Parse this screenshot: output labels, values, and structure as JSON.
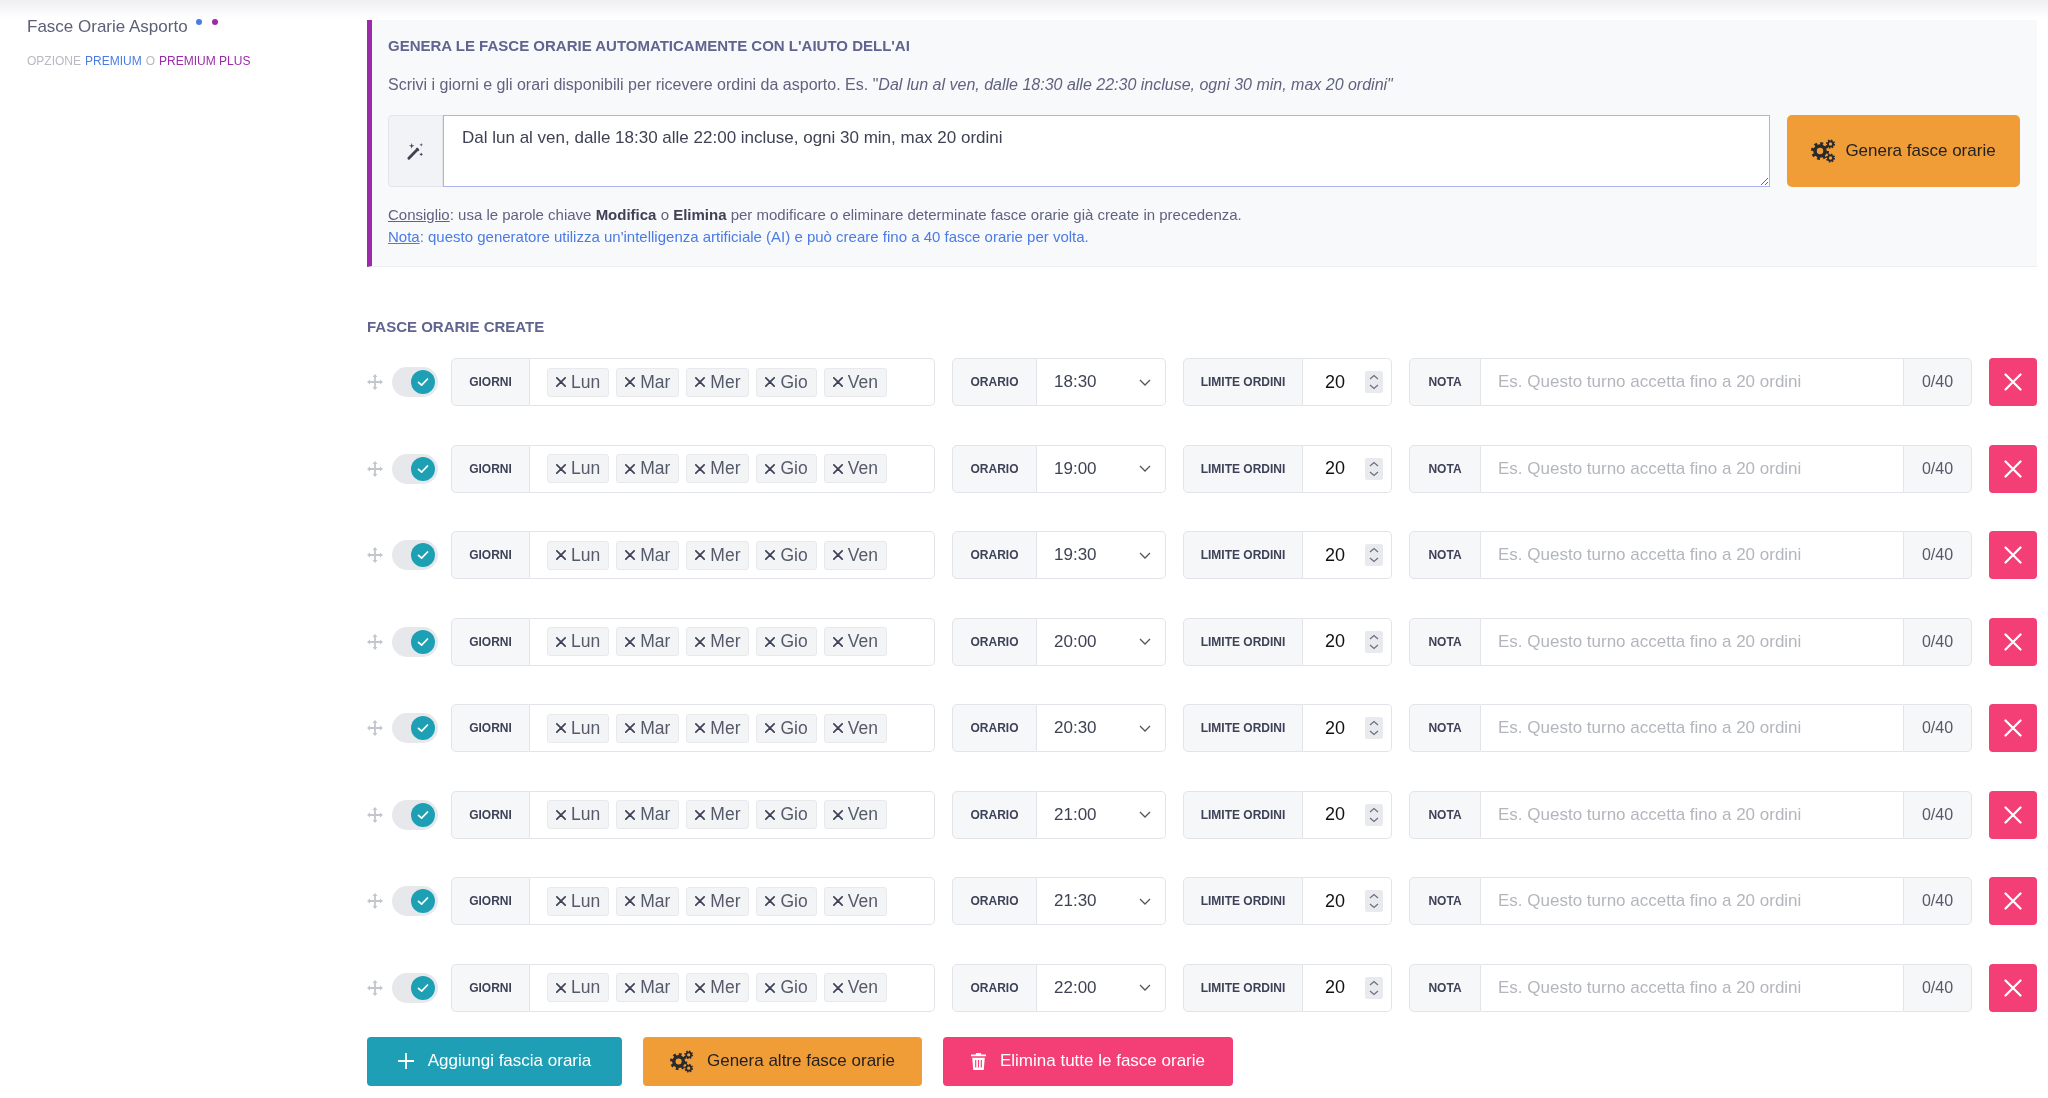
{
  "sidebar": {
    "title": "Fasce Orarie Asporto",
    "dots": [
      {
        "color": "#4b7be5"
      },
      {
        "color": "#9b2ba9"
      }
    ],
    "plan_note": {
      "prefix": "OPZIONE",
      "separator": "O",
      "plans": [
        {
          "name": "PREMIUM",
          "color": "#4b7be5"
        },
        {
          "name": "PREMIUM PLUS",
          "color": "#9b2ba9"
        }
      ]
    }
  },
  "ai_generator": {
    "title": "GENERA LE FASCE ORARIE AUTOMATICAMENTE CON L'AIUTO DELL'AI",
    "description": "Scrivi i giorni e gli orari disponibili per ricevere ordini da asporto. Es. \"*Dal lun al ven, dalle 18:30 alle 22:30 incluse, ogni 30 min, max 20 ordini\"*",
    "prompt": {
      "value": "Dal lun al ven, dalle 18:30 alle 22:00 incluse, ogni 30 min, max 20 ordini"
    },
    "button": {
      "label": "Genera fasce orarie"
    },
    "tip": {
      "link": "Consiglio",
      "text": ": usa le parole chiave **Modifica** o **Elimina** per modificare o eliminare determinate fasce orarie già create in precedenza."
    },
    "note": {
      "link": "Nota",
      "text": ": questo generatore utilizza un'intelligenza artificiale (AI) e può creare fino a 40 fasce orarie per volta."
    }
  },
  "slots_section": {
    "title": "FASCE ORARIE CREATE",
    "slots": [
      {
        "on": true,
        "days_label": "GIORNI",
        "days": [
          "Lun",
          "Mar",
          "Mer",
          "Gio",
          "Ven"
        ],
        "time_label": "ORARIO",
        "time": "18:30",
        "limit_label": "LIMITE ORDINI",
        "limit": "20",
        "note_label": "NOTA",
        "note_placeholder": "Es. Questo turno accetta fino a 20 ordini",
        "note_counter": "0/40"
      },
      {
        "on": true,
        "days_label": "GIORNI",
        "days": [
          "Lun",
          "Mar",
          "Mer",
          "Gio",
          "Ven"
        ],
        "time_label": "ORARIO",
        "time": "19:00",
        "limit_label": "LIMITE ORDINI",
        "limit": "20",
        "note_label": "NOTA",
        "note_placeholder": "Es. Questo turno accetta fino a 20 ordini",
        "note_counter": "0/40"
      },
      {
        "on": true,
        "days_label": "GIORNI",
        "days": [
          "Lun",
          "Mar",
          "Mer",
          "Gio",
          "Ven"
        ],
        "time_label": "ORARIO",
        "time": "19:30",
        "limit_label": "LIMITE ORDINI",
        "limit": "20",
        "note_label": "NOTA",
        "note_placeholder": "Es. Questo turno accetta fino a 20 ordini",
        "note_counter": "0/40"
      },
      {
        "on": true,
        "days_label": "GIORNI",
        "days": [
          "Lun",
          "Mar",
          "Mer",
          "Gio",
          "Ven"
        ],
        "time_label": "ORARIO",
        "time": "20:00",
        "limit_label": "LIMITE ORDINI",
        "limit": "20",
        "note_label": "NOTA",
        "note_placeholder": "Es. Questo turno accetta fino a 20 ordini",
        "note_counter": "0/40"
      },
      {
        "on": true,
        "days_label": "GIORNI",
        "days": [
          "Lun",
          "Mar",
          "Mer",
          "Gio",
          "Ven"
        ],
        "time_label": "ORARIO",
        "time": "20:30",
        "limit_label": "LIMITE ORDINI",
        "limit": "20",
        "note_label": "NOTA",
        "note_placeholder": "Es. Questo turno accetta fino a 20 ordini",
        "note_counter": "0/40"
      },
      {
        "on": true,
        "days_label": "GIORNI",
        "days": [
          "Lun",
          "Mar",
          "Mer",
          "Gio",
          "Ven"
        ],
        "time_label": "ORARIO",
        "time": "21:00",
        "limit_label": "LIMITE ORDINI",
        "limit": "20",
        "note_label": "NOTA",
        "note_placeholder": "Es. Questo turno accetta fino a 20 ordini",
        "note_counter": "0/40"
      },
      {
        "on": true,
        "days_label": "GIORNI",
        "days": [
          "Lun",
          "Mar",
          "Mer",
          "Gio",
          "Ven"
        ],
        "time_label": "ORARIO",
        "time": "21:30",
        "limit_label": "LIMITE ORDINI",
        "limit": "20",
        "note_label": "NOTA",
        "note_placeholder": "Es. Questo turno accetta fino a 20 ordini",
        "note_counter": "0/40"
      },
      {
        "on": true,
        "days_label": "GIORNI",
        "days": [
          "Lun",
          "Mar",
          "Mer",
          "Gio",
          "Ven"
        ],
        "time_label": "ORARIO",
        "time": "22:00",
        "limit_label": "LIMITE ORDINI",
        "limit": "20",
        "note_label": "NOTA",
        "note_placeholder": "Es. Questo turno accetta fino a 20 ordini",
        "note_counter": "0/40"
      }
    ],
    "actions": [
      {
        "kind": "add",
        "label": "Aggiungi fascia oraria"
      },
      {
        "kind": "generate",
        "label": "Genera altre fasce orarie"
      },
      {
        "kind": "delete_all",
        "label": "Elimina tutte le fasce orarie"
      }
    ]
  }
}
